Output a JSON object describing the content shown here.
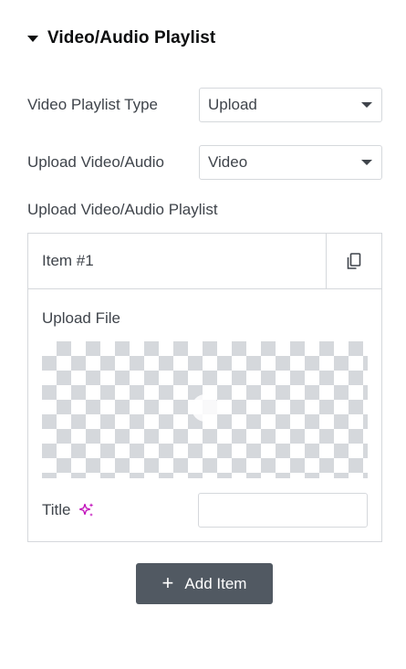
{
  "section": {
    "title": "Video/Audio Playlist",
    "expanded": true
  },
  "fields": {
    "playlist_type": {
      "label": "Video Playlist Type",
      "value": "Upload"
    },
    "upload_type": {
      "label": "Upload Video/Audio",
      "value": "Video"
    },
    "playlist_label": "Upload Video/Audio Playlist"
  },
  "repeater": {
    "items": [
      {
        "title": "Item #1",
        "upload_label": "Upload File",
        "title_field_label": "Title",
        "title_value": ""
      }
    ],
    "add_button_label": "Add Item"
  },
  "icons": {
    "section_toggle": "caret-down-icon",
    "select_arrow": "chevron-down-icon",
    "duplicate": "copy-icon",
    "ai": "sparkles-icon",
    "add": "plus-icon"
  },
  "colors": {
    "ai_accent": "#c00bb9",
    "button_bg": "#515962",
    "border": "#d5d8dc",
    "text": "#3f444b"
  }
}
